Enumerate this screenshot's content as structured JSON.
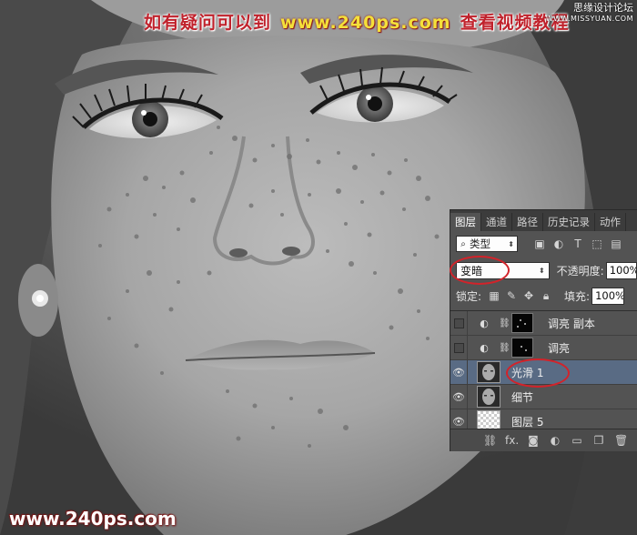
{
  "banner": {
    "prefix": "如有疑问可以到",
    "url": "www.240ps.com",
    "suffix": "查看视频教程"
  },
  "watermark": {
    "line1": "思缘设计论坛",
    "line2": "WWW.MISSYUAN.COM"
  },
  "footer_url": "www.240ps.com",
  "panel": {
    "tabs": [
      "图层",
      "通道",
      "路径",
      "历史记录",
      "动作"
    ],
    "active_tab": 0,
    "filter": {
      "value": "类型",
      "search_icon": "search-icon"
    },
    "filter_icons": [
      "image-filter-icon",
      "adjustment-filter-icon",
      "type-filter-icon",
      "shape-filter-icon",
      "smart-object-filter-icon"
    ],
    "blend_mode": "变暗",
    "opacity_label": "不透明度:",
    "opacity_value": "100%",
    "lock_label": "锁定:",
    "fill_label": "填充:",
    "fill_value": "100%",
    "layers": [
      {
        "name": "调亮 副本",
        "visible": false,
        "type": "adjustment",
        "selected": false
      },
      {
        "name": "调亮",
        "visible": false,
        "type": "adjustment",
        "selected": false
      },
      {
        "name": "光滑 1",
        "visible": true,
        "type": "pixel",
        "selected": true
      },
      {
        "name": "细节",
        "visible": true,
        "type": "pixel",
        "selected": false
      },
      {
        "name": "图层 5",
        "visible": true,
        "type": "transparent",
        "selected": false
      }
    ],
    "bottom_icons": [
      "link-layers-icon",
      "fx-icon",
      "add-mask-icon",
      "adjustment-layer-icon",
      "new-group-icon",
      "new-layer-icon",
      "delete-icon"
    ],
    "bottom_fx": "fx."
  },
  "colors": {
    "panel_bg": "#535353",
    "selected_layer": "#596b84",
    "highlight_red": "#d2232a"
  }
}
